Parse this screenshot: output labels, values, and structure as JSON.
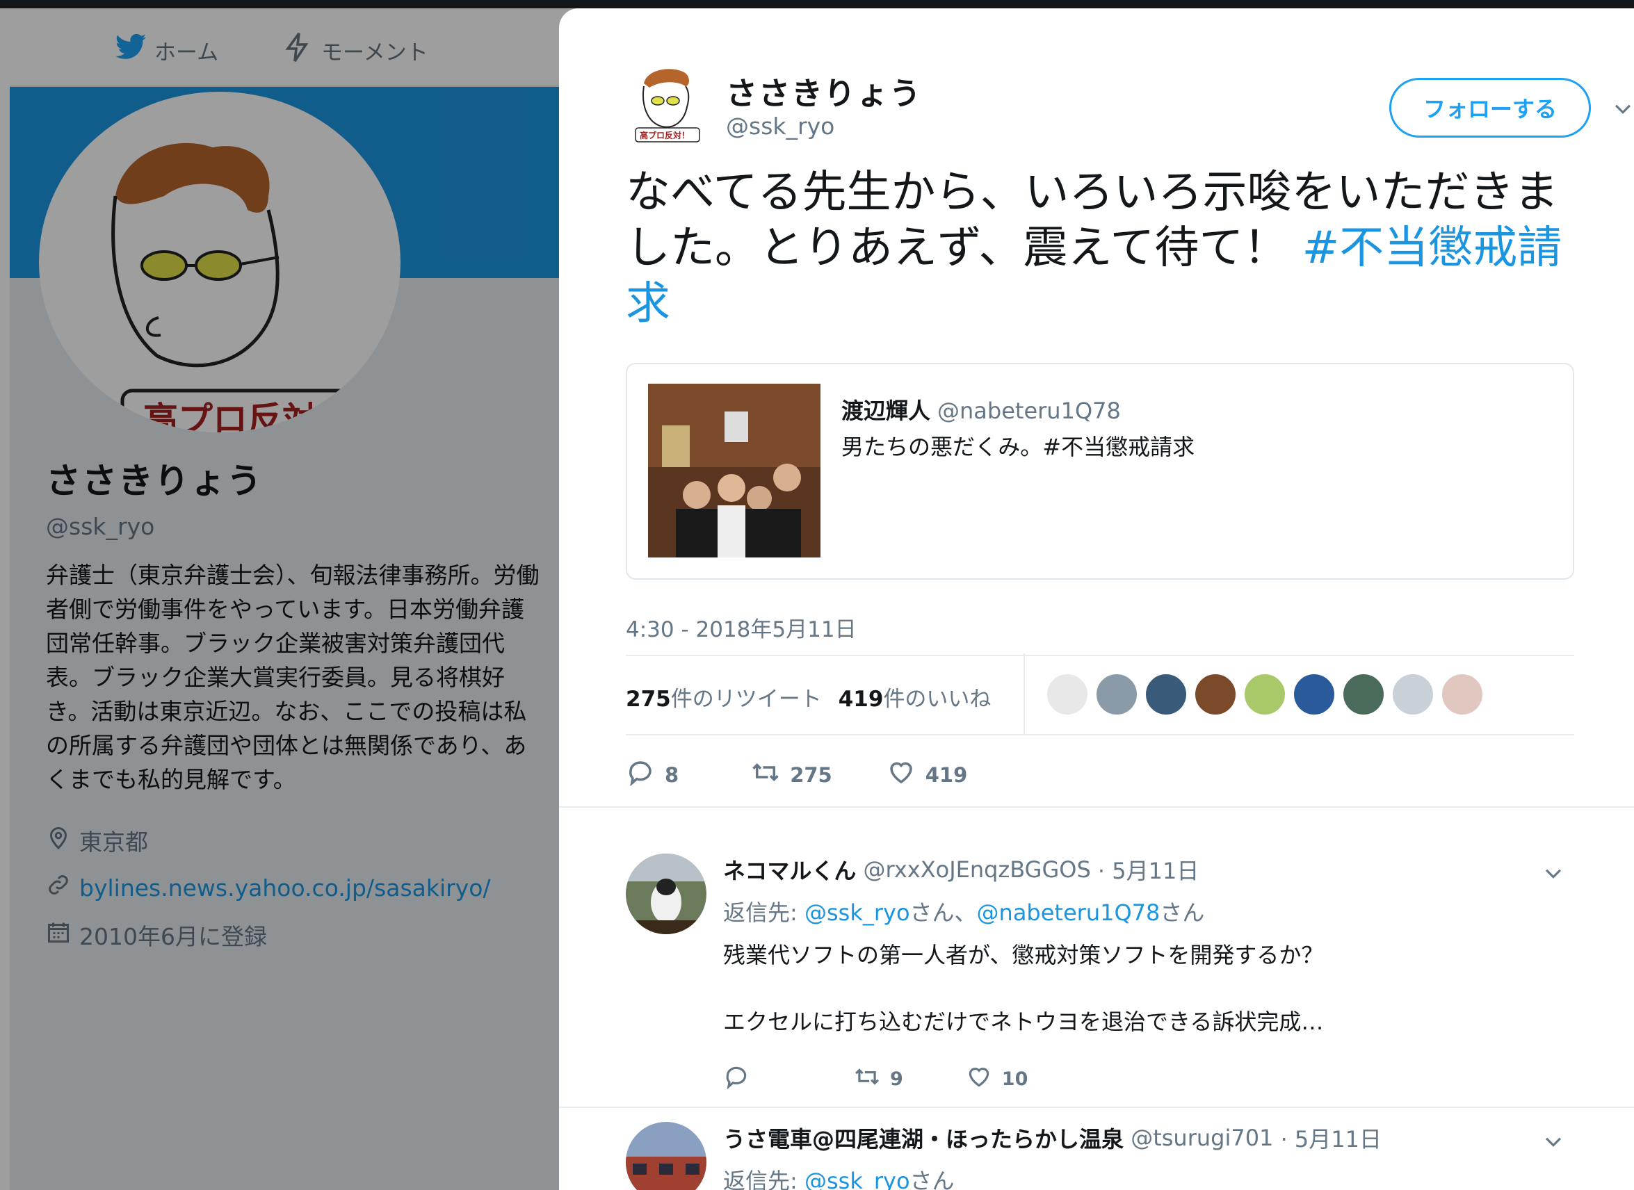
{
  "background_profile": {
    "nav": {
      "home_label": "ホーム",
      "moments_label": "モーメント"
    },
    "avatar_caption": "高プロ反対！",
    "name": "ささきりょう",
    "handle": "@ssk_ryo",
    "bio": "弁護士（東京弁護士会）、旬報法律事務所。労働者側で労働事件をやっています。日本労働弁護団常任幹事。ブラック企業被害対策弁護団代表。ブラック企業大賞実行委員。見る将棋好き。活動は東京近辺。なお、ここでの投稿は私の所属する弁護団や団体とは無関係であり、あくまでも私的見解です。",
    "location": "東京都",
    "url": "bylines.news.yahoo.co.jp/sasakiryo/",
    "joined": "2010年6月に登録"
  },
  "tweet": {
    "author_name": "ささきりょう",
    "author_handle": "@ssk_ryo",
    "avatar_caption": "高プロ反対！",
    "follow_label": "フォローする",
    "text": "なべてる先生から、いろいろ示唆をいただきました。とりあえず、震えて待て！",
    "hashtag": "#不当懲戒請求",
    "quote": {
      "name": "渡辺輝人",
      "handle": "@nabeteru1Q78",
      "text": "男たちの悪だくみ。#不当懲戒請求"
    },
    "timestamp": "4:30 - 2018年5月11日",
    "retweet_count": "275",
    "retweet_label": "件のリツイート",
    "like_count": "419",
    "like_label": "件のいいね",
    "actions": {
      "replies": "8",
      "retweets": "275",
      "likes": "419"
    }
  },
  "replies": [
    {
      "name": "ネコマルくん",
      "handle": "@rxxXoJEnqzBGGOS",
      "date": "· 5月11日",
      "reply_to_prefix": "返信先: ",
      "reply_to_1": "@ssk_ryo",
      "san_1": "さん、",
      "reply_to_2": "@nabeteru1Q78",
      "san_2": "さん",
      "text": "残業代ソフトの第一人者が、懲戒対策ソフトを開発するか？\n\nエクセルに打ち込むだけでネトウヨを退治できる訴状完成…",
      "retweets": "9",
      "likes": "10"
    },
    {
      "name": "うさ電車@四尾連湖・ほったらかし温泉",
      "handle": "@tsurugi701",
      "date": "· 5月11日",
      "reply_to_prefix": "返信先: ",
      "reply_to_1": "@ssk_ryo",
      "san_1": "さん"
    }
  ],
  "colors": {
    "accent": "#1da1f2",
    "link": "#1b95e0",
    "muted": "#657786",
    "banner": "#1b95e0"
  }
}
